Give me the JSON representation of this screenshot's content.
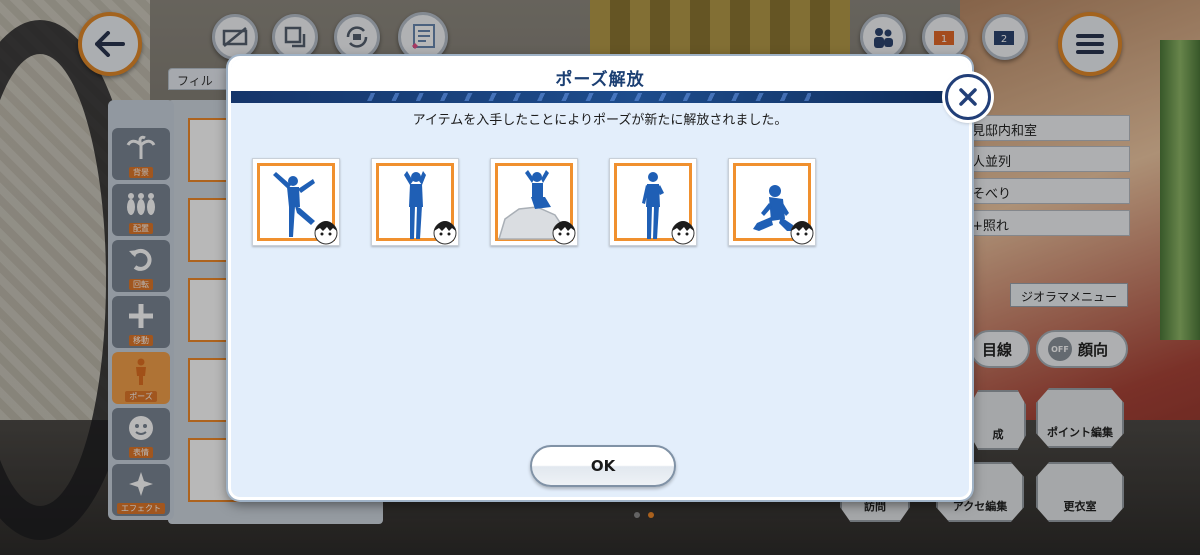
{
  "modal": {
    "title": "ポーズ解放",
    "message": "アイテムを入手したことによりポーズが新たに解放されました。",
    "ok_label": "OK",
    "poses": [
      {
        "icon": "pose-dancing-icon"
      },
      {
        "icon": "pose-standing-hands-up-icon"
      },
      {
        "icon": "pose-sitting-rock-icon"
      },
      {
        "icon": "pose-standing-icon"
      },
      {
        "icon": "pose-kneeling-icon"
      }
    ]
  },
  "left_panel": {
    "filter_tab_label": "フィル",
    "tabs": [
      {
        "label": "背景",
        "icon": "palm-tree-icon"
      },
      {
        "label": "配置",
        "icon": "bowling-pins-icon"
      },
      {
        "label": "回転",
        "icon": "rotate-icon"
      },
      {
        "label": "移動",
        "icon": "move-arrows-icon"
      },
      {
        "label": "ポーズ",
        "icon": "figure-icon",
        "active": true
      },
      {
        "label": "表情",
        "icon": "face-icon"
      },
      {
        "label": "エフェクト",
        "icon": "sparkle-icon"
      }
    ]
  },
  "right_panel": {
    "rows": [
      "見邸内和室",
      "人並列",
      "そべり",
      "+照れ"
    ],
    "diorama_menu_label": "ジオラマメニュー",
    "gaze_label": "目線",
    "face_direction_label": "顔向",
    "off_label": "OFF",
    "bottom_buttons": [
      "成",
      "ポイント編集",
      "訪問",
      "アクセ編集",
      "更衣室"
    ]
  },
  "colors": {
    "accent_orange": "#f0902e",
    "title_navy": "#1b3f73",
    "pose_blue": "#1f5fb5"
  }
}
